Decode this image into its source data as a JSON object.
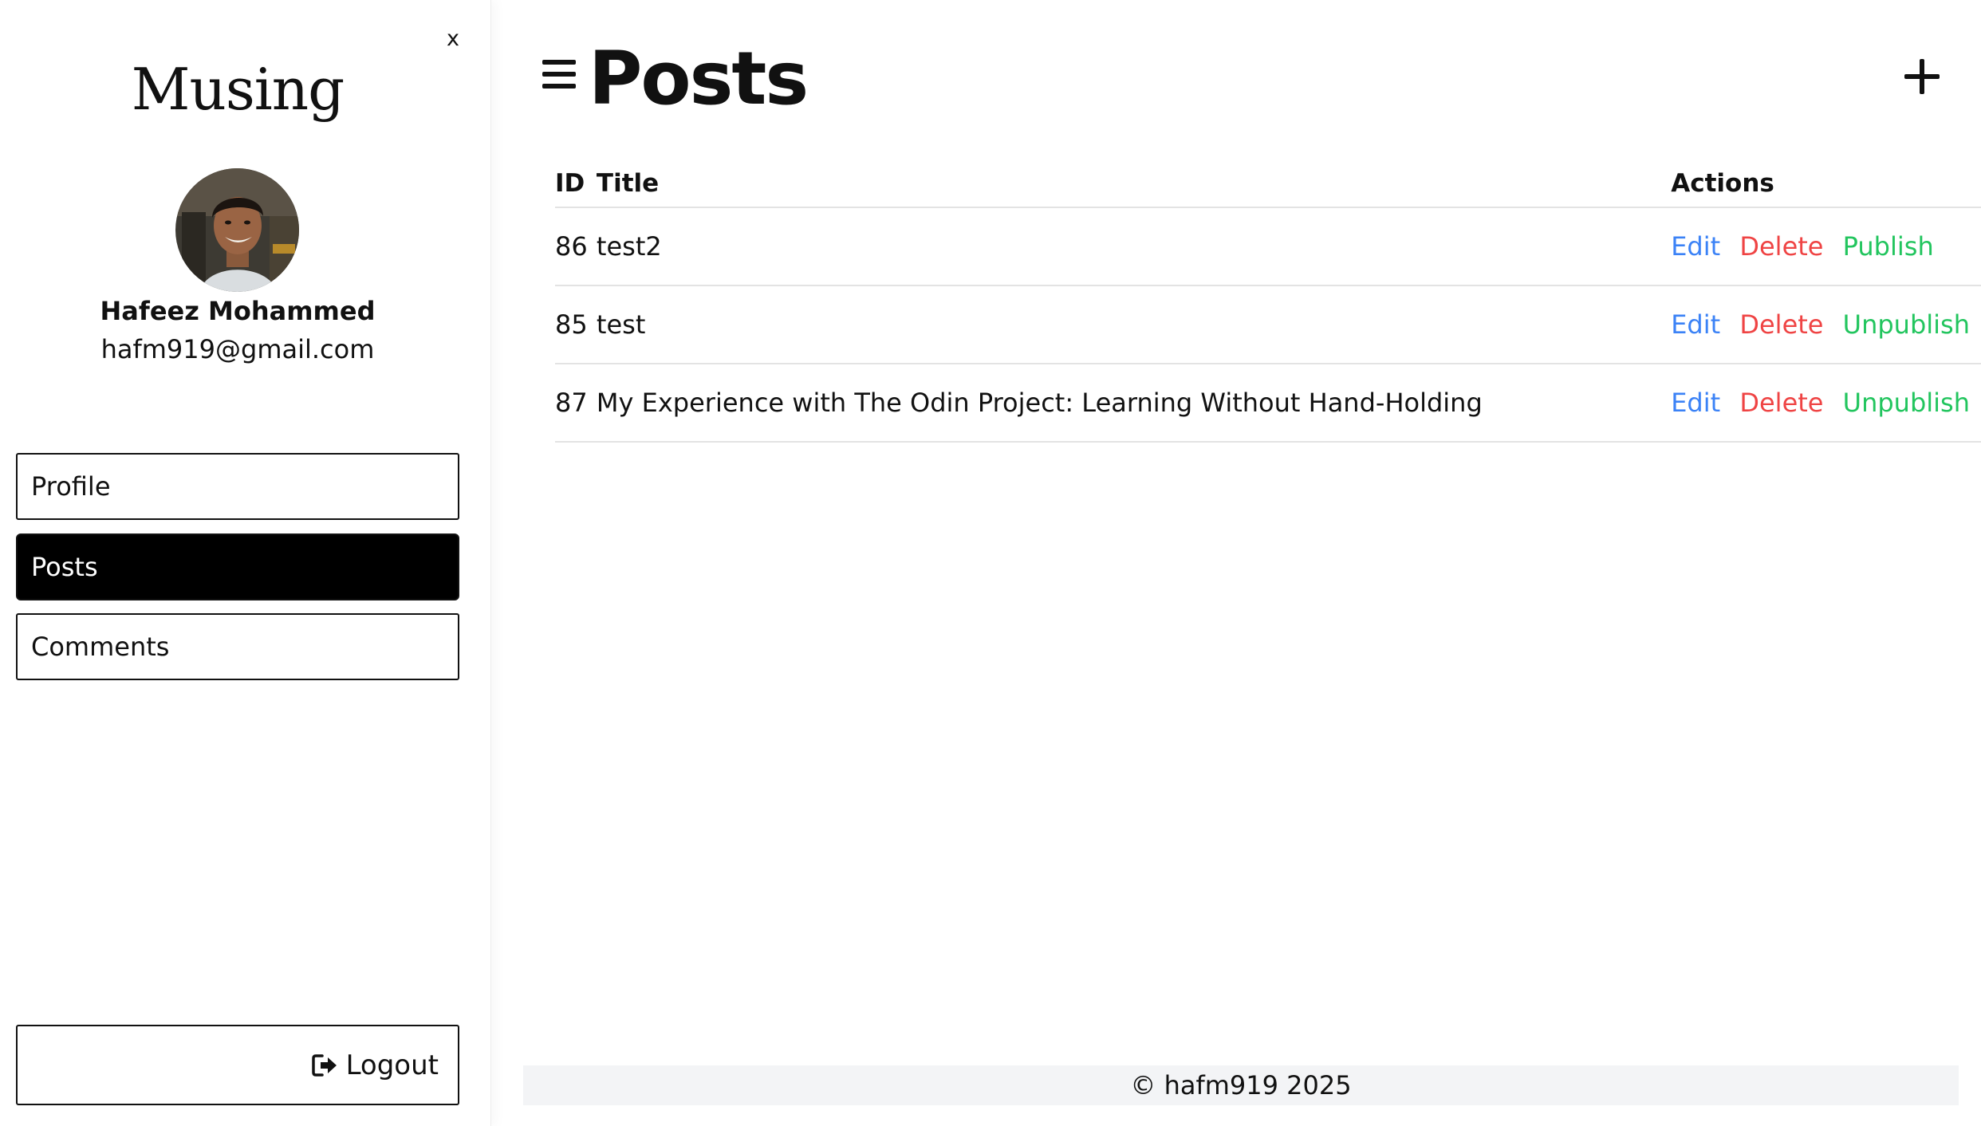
{
  "sidebar": {
    "close_label": "x",
    "brand": "Musing",
    "user": {
      "name": "Hafeez Mohammed",
      "email": "hafm919@gmail.com"
    },
    "nav": [
      {
        "label": "Profile",
        "active": false
      },
      {
        "label": "Posts",
        "active": true
      },
      {
        "label": "Comments",
        "active": false
      }
    ],
    "logout_label": "Logout",
    "logout_icon": "sign-out-icon"
  },
  "header": {
    "menu_icon": "hamburger-icon",
    "title": "Posts",
    "add_icon": "plus-icon"
  },
  "table": {
    "columns": {
      "id": "ID",
      "title": "Title",
      "actions": "Actions"
    },
    "rows": [
      {
        "id": "86",
        "title": "test2",
        "edit": "Edit",
        "delete": "Delete",
        "toggle": "Publish"
      },
      {
        "id": "85",
        "title": "test",
        "edit": "Edit",
        "delete": "Delete",
        "toggle": "Unpublish"
      },
      {
        "id": "87",
        "title": "My Experience with The Odin Project: Learning Without Hand-Holding",
        "edit": "Edit",
        "delete": "Delete",
        "toggle": "Unpublish"
      }
    ]
  },
  "footer": {
    "text": "© hafm919 2025"
  },
  "colors": {
    "edit": "#3b82f6",
    "delete": "#ef4444",
    "publish": "#22c55e",
    "active_nav_bg": "#000000",
    "footer_bg": "#f3f4f6"
  }
}
